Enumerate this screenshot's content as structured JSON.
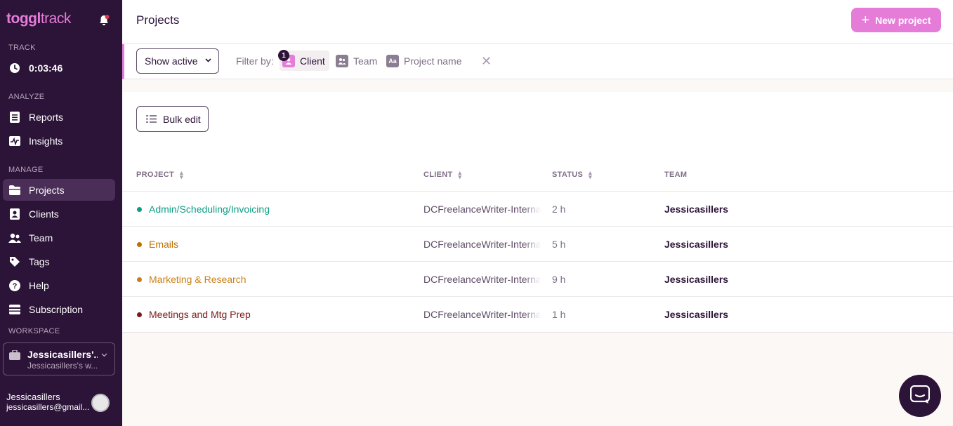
{
  "sidebar": {
    "logo_main": "toggl",
    "logo_sub": "track",
    "track_label": "TRACK",
    "timer": "0:03:46",
    "analyze_label": "ANALYZE",
    "manage_label": "MANAGE",
    "workspace_label": "WORKSPACE",
    "items": {
      "reports": "Reports",
      "insights": "Insights",
      "projects": "Projects",
      "clients": "Clients",
      "team": "Team",
      "tags": "Tags",
      "help": "Help",
      "subscription": "Subscription"
    },
    "workspace": {
      "name": "Jessicasillers'...",
      "sub": "Jessicasillers's w..."
    },
    "user": {
      "name": "Jessicasillers",
      "email": "jessicasillers@gmail..."
    }
  },
  "header": {
    "title": "Projects",
    "new_project": "New project"
  },
  "filters": {
    "show_active": "Show active",
    "filter_by": "Filter by:",
    "client": "Client",
    "client_count": "1",
    "team": "Team",
    "project_name": "Project name"
  },
  "toolbar": {
    "bulk_edit": "Bulk edit"
  },
  "table": {
    "columns": {
      "project": "PROJECT",
      "client": "CLIENT",
      "status": "STATUS",
      "team": "TEAM"
    },
    "rows": [
      {
        "project": "Admin/Scheduling/Invoicing",
        "color": "#0b9e84",
        "client": "DCFreelanceWriter-Internal",
        "status": "2 h",
        "team": "Jessicasillers"
      },
      {
        "project": "Emails",
        "color": "#bf7000",
        "client": "DCFreelanceWriter-Internal",
        "status": "5 h",
        "team": "Jessicasillers"
      },
      {
        "project": "Marketing & Research",
        "color": "#c9801a",
        "client": "DCFreelanceWriter-Internal",
        "status": "9 h",
        "team": "Jessicasillers"
      },
      {
        "project": "Meetings and Mtg Prep",
        "color": "#7a1a1a",
        "client": "DCFreelanceWriter-Internal",
        "status": "1 h",
        "team": "Jessicasillers"
      }
    ]
  },
  "colors": {
    "accent": "#e57cd8",
    "sidebar_bg": "#2c1338"
  }
}
